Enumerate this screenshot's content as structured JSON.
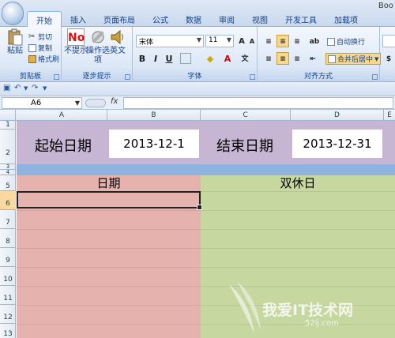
{
  "window": {
    "title_fragment": "Boo"
  },
  "tabs": [
    "开始",
    "插入",
    "页面布局",
    "公式",
    "数据",
    "审阅",
    "视图",
    "开发工具",
    "加载项"
  ],
  "ribbon": {
    "clipboard": {
      "paste": "粘贴",
      "cut": "剪切",
      "copy": "复制",
      "format_painter": "格式刷",
      "group": "剪贴板"
    },
    "tips": {
      "no_label": "不提示",
      "options": "操作选项",
      "english": "英文",
      "group": "逐步提示"
    },
    "font": {
      "name": "宋体",
      "size": "11",
      "bold": "B",
      "italic": "I",
      "underline": "U",
      "group": "字体"
    },
    "alignment": {
      "wrap": "自动换行",
      "merge": "合并后居中",
      "group": "对齐方式"
    }
  },
  "formula_bar": {
    "name_box": "A6",
    "fx": "fx",
    "value": ""
  },
  "columns": [
    "A",
    "B",
    "C",
    "D",
    "E"
  ],
  "rows": [
    "1",
    "2",
    "3",
    "4",
    "5",
    "6",
    "7",
    "8",
    "9",
    "10",
    "11",
    "12",
    "13"
  ],
  "sheet": {
    "start_label": "起始日期",
    "start_value": "2013-12-1",
    "end_label": "结束日期",
    "end_value": "2013-12-31",
    "date_header": "日期",
    "weekend_header": "双休日"
  },
  "colors": {
    "purple_band": "#c7b6d3",
    "blue_band": "#8fb3df",
    "pink_col": "#e6b2ae",
    "green_col": "#c6d7a0"
  },
  "watermark": {
    "text": "我爱IT技术网",
    "sub": "52ij.com"
  }
}
